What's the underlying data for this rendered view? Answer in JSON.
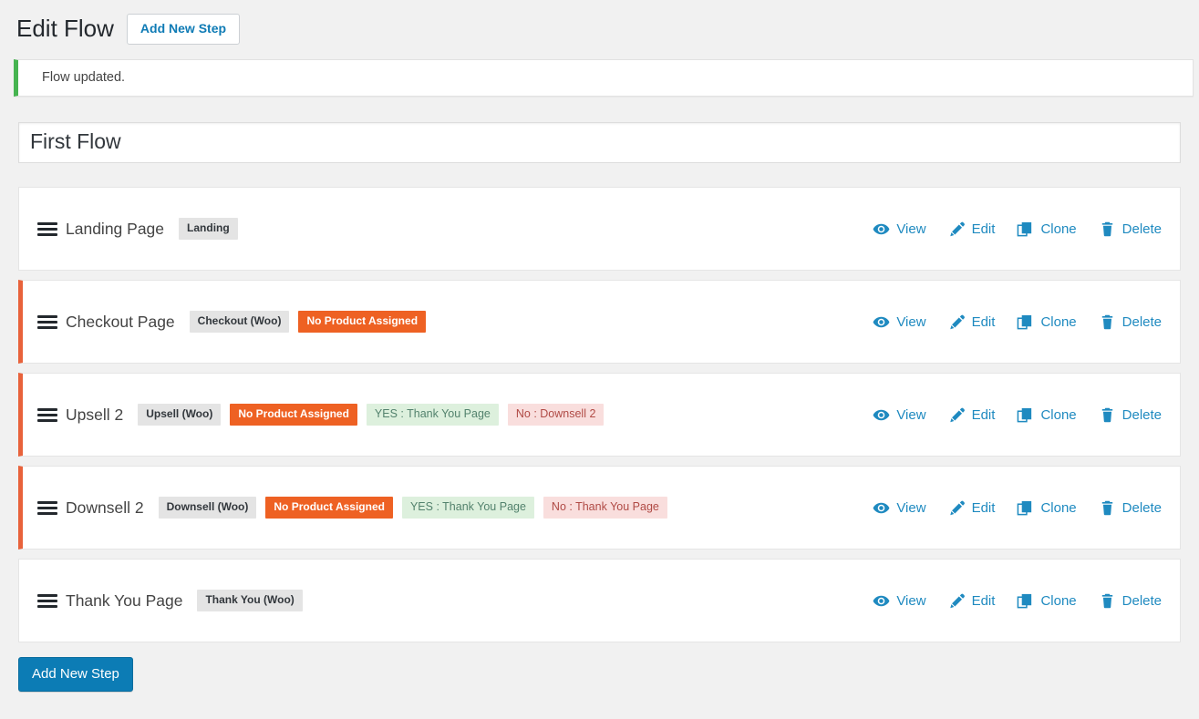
{
  "header": {
    "title": "Edit Flow",
    "add_new_step_label": "Add New Step"
  },
  "notice": {
    "text": "Flow updated.",
    "accent_color": "#46b450"
  },
  "flow_title": {
    "value": "First Flow",
    "placeholder": "Enter flow name here"
  },
  "colors": {
    "accent_orange": "#e8623b",
    "badge_warn_bg": "#ee6123",
    "badge_gray_bg": "#e4e4e4",
    "badge_yes_bg": "#ddf0dd",
    "badge_no_bg": "#f9dedd",
    "link_blue": "#1f8ac0",
    "button_blue": "#0c7cb5"
  },
  "actions": {
    "view": "View",
    "edit": "Edit",
    "clone": "Clone",
    "delete": "Delete"
  },
  "steps": [
    {
      "name": "Landing Page",
      "accented": false,
      "badges": [
        {
          "text": "Landing",
          "kind": "type"
        }
      ]
    },
    {
      "name": "Checkout Page",
      "accented": true,
      "badges": [
        {
          "text": "Checkout (Woo)",
          "kind": "type"
        },
        {
          "text": "No Product Assigned",
          "kind": "warn"
        }
      ]
    },
    {
      "name": "Upsell 2",
      "accented": true,
      "badges": [
        {
          "text": "Upsell (Woo)",
          "kind": "type"
        },
        {
          "text": "No Product Assigned",
          "kind": "warn"
        },
        {
          "text": "YES : Thank You Page",
          "kind": "yes"
        },
        {
          "text": "No : Downsell 2",
          "kind": "no"
        }
      ]
    },
    {
      "name": "Downsell 2",
      "accented": true,
      "badges": [
        {
          "text": "Downsell (Woo)",
          "kind": "type"
        },
        {
          "text": "No Product Assigned",
          "kind": "warn"
        },
        {
          "text": "YES : Thank You Page",
          "kind": "yes"
        },
        {
          "text": "No : Thank You Page",
          "kind": "no"
        }
      ]
    },
    {
      "name": "Thank You Page",
      "accented": false,
      "badges": [
        {
          "text": "Thank You (Woo)",
          "kind": "type"
        }
      ]
    }
  ],
  "footer": {
    "add_new_step_label": "Add New Step"
  }
}
